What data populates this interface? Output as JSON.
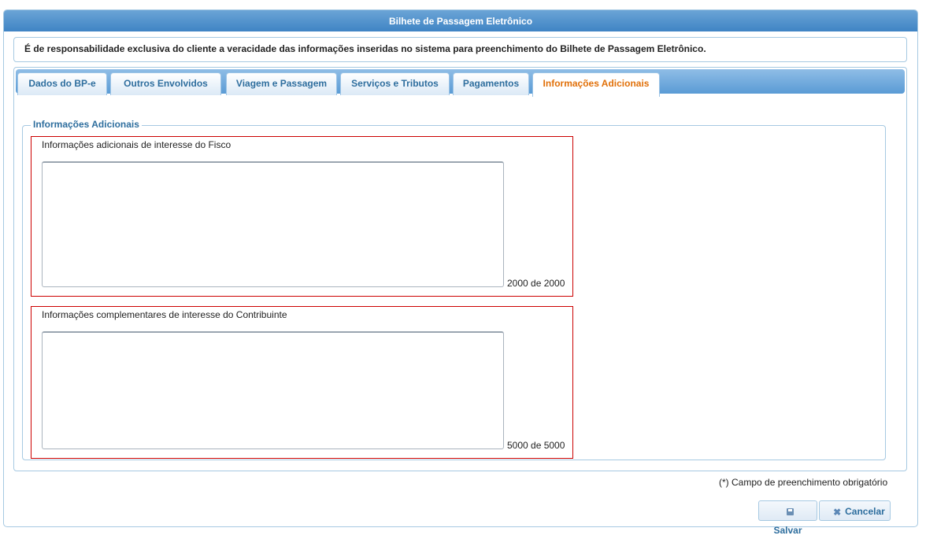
{
  "window": {
    "title": "Bilhete de Passagem Eletrônico"
  },
  "notice": "É de responsabilidade exclusiva do cliente a veracidade das informações inseridas no sistema para preenchimento do Bilhete de Passagem Eletrônico.",
  "tabs": [
    {
      "label": "Dados do BP-e"
    },
    {
      "label": "Outros Envolvidos"
    },
    {
      "label": "Viagem e Passagem"
    },
    {
      "label": "Serviços e Tributos"
    },
    {
      "label": "Pagamentos"
    },
    {
      "label": "Informações Adicionais"
    }
  ],
  "active_tab": "Informações Adicionais",
  "section": {
    "legend": "Informações Adicionais",
    "fisco": {
      "label": "Informações adicionais de interesse do Fisco",
      "value": "",
      "counter": "2000 de 2000"
    },
    "contribuinte": {
      "label": "Informações complementares de interesse do Contribuinte",
      "value": "",
      "counter": "5000 de 5000"
    }
  },
  "footer": {
    "required_note": "(*) Campo de preenchimento obrigatório",
    "save_label": "Salvar",
    "cancel_label": "Cancelar"
  },
  "colors": {
    "accent": "#3f84c4",
    "active_tab": "#e17009",
    "error_border": "#cc0000",
    "link": "#2e6e9e"
  },
  "icons": {
    "save": "floppy-disk-icon",
    "cancel": "close-icon"
  }
}
